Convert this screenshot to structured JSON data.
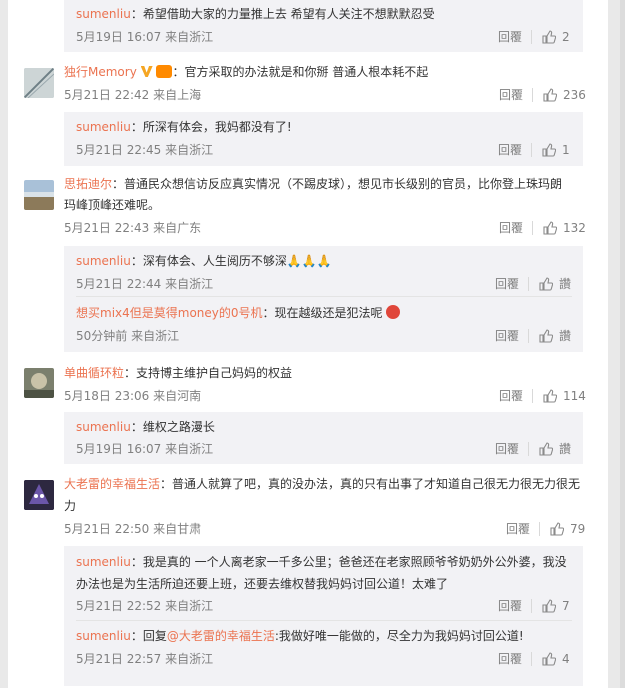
{
  "comments": [
    {
      "type": "sub-top",
      "user": "sumenliu",
      "text": "：希望借助大家的力量推上去 希望有人关注不想默默忍受",
      "time": "5月19日 16:07",
      "location": "来自浙江",
      "reply_label": "回覆",
      "likes": "2"
    },
    {
      "type": "main",
      "user": "独行Memory",
      "text": "：官方采取的办法就是和你掰 普通人根本耗不起",
      "time": "5月21日 22:42",
      "location": "来自上海",
      "reply_label": "回覆",
      "likes": "236"
    },
    {
      "type": "sub",
      "user": "sumenliu",
      "text": "：所深有体会，我妈都没有了!",
      "time": "5月21日 22:45",
      "location": "来自浙江",
      "reply_label": "回覆",
      "likes": "1"
    },
    {
      "type": "main",
      "user": "思拓迪尔",
      "text_line1": "：普通民众想信访反应真实情况（不踢皮球），想见市长级别的官员，比你登上珠玛朗",
      "text_line2": "玛峰顶峰还难呢。",
      "time": "5月21日 22:43",
      "location": "来自广东",
      "reply_label": "回覆",
      "likes": "132"
    },
    {
      "type": "sub",
      "user": "sumenliu",
      "text": "：深有体会、人生阅历不够深🙏🙏🙏",
      "time": "5月21日 22:44",
      "location": "来自浙江",
      "reply_label": "回覆",
      "likes": "讚"
    },
    {
      "type": "sub",
      "user": "想买mix4但是莫得money的0号机",
      "text": "：现在越级还是犯法呢",
      "time": "50分钟前",
      "location": "来自浙江",
      "reply_label": "回覆",
      "likes": "讚"
    },
    {
      "type": "main",
      "user": "单曲循环粒",
      "text": "：支持博主维护自己妈妈的权益",
      "time": "5月18日 23:06",
      "location": "来自河南",
      "reply_label": "回覆",
      "likes": "114"
    },
    {
      "type": "sub",
      "user": "sumenliu",
      "text": "：维权之路漫长",
      "time": "5月19日 16:07",
      "location": "来自浙江",
      "reply_label": "回覆",
      "likes": "讚"
    },
    {
      "type": "main",
      "user": "大老雷的幸福生活",
      "text_line1": "：普通人就算了吧，真的没办法，真的只有出事了才知道自己很无力很无力很无",
      "text_line2": "力",
      "time": "5月21日 22:50",
      "location": "来自甘肃",
      "reply_label": "回覆",
      "likes": "79"
    },
    {
      "type": "sub",
      "user": "sumenliu",
      "text_line1": "：我是真的 一个人离老家一千多公里；爸爸还在老家照顾爷爷奶奶外公外婆，我没",
      "text_line2": "办法也是为生活所迫还要上班，还要去维权替我妈妈讨回公道！太难了",
      "time": "5月21日 22:52",
      "location": "来自浙江",
      "reply_label": "回覆",
      "likes": "7"
    },
    {
      "type": "sub",
      "user": "sumenliu",
      "reply_prefix": "：回复",
      "mention": "@大老雷的幸福生活",
      "text": ":我做好唯一能做的，尽全力为我妈妈讨回公道!",
      "time": "5月21日 22:57",
      "location": "来自浙江",
      "reply_label": "回覆",
      "likes": "4"
    }
  ],
  "colors": {
    "username": "#eb7350",
    "meta": "#808080",
    "subbox": "#f2f2f5"
  }
}
